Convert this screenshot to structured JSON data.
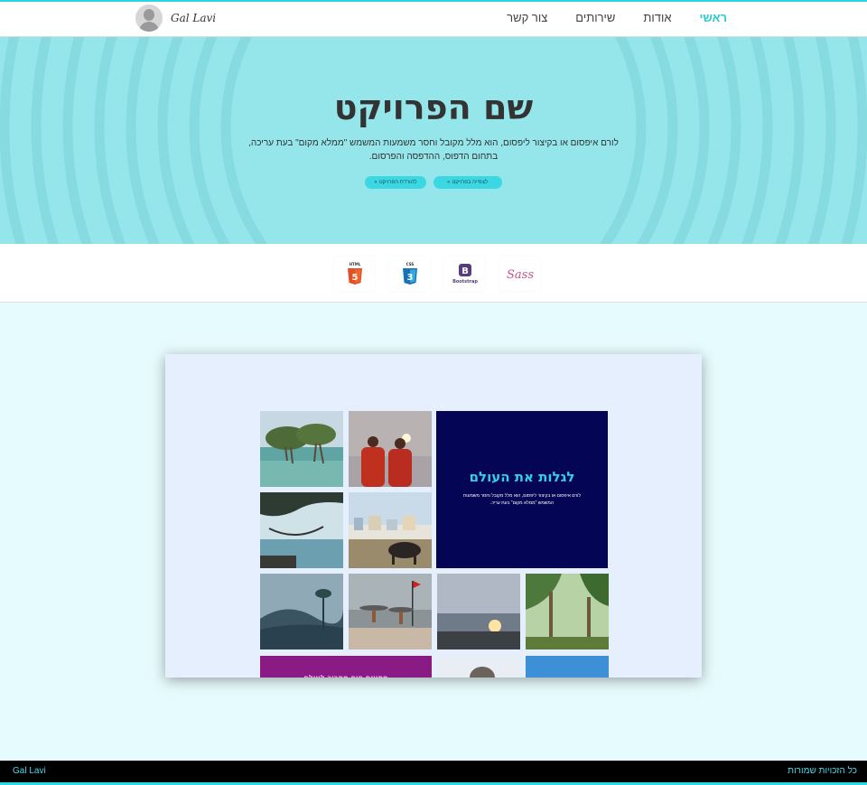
{
  "header": {
    "logo_text": "Gal Lavi",
    "nav": [
      {
        "label": "ראשי",
        "active": true
      },
      {
        "label": "אודות",
        "active": false
      },
      {
        "label": "שירותים",
        "active": false
      },
      {
        "label": "צור קשר",
        "active": false
      }
    ]
  },
  "hero": {
    "title": "שם הפרויקט",
    "description_line1": "לורם איפסום או בקיצור ליפסום, הוא מלל מקובל וחסר משמעות המשמש \"ממלא מקום\" בעת עריכה,",
    "description_line2": "בתחום הדפוס, ההדפסה והפרסום.",
    "buttons": [
      {
        "label": "לצפייה בפרויקט",
        "icon": "double-chevron-left"
      },
      {
        "label": "להורדת הפרויקט",
        "icon": "double-chevron-left"
      }
    ]
  },
  "technologies": [
    {
      "name": "Sass",
      "color": "#c6538c"
    },
    {
      "name": "Bootstrap",
      "color": "#563d7c"
    },
    {
      "name": "CSS",
      "color": "#1572b6"
    },
    {
      "name": "HTML",
      "color": "#e34f26"
    }
  ],
  "preview": {
    "feature_title": "לגלות את העולם",
    "feature_text": "לורם איפסום או בקיצור ליפסום, הוא מלל מקובל וחסר משמעות המשמש \"ממלא מקום\" בעת עריכ.",
    "promo_text": "מסעות חוף מסביב לעולם"
  },
  "footer": {
    "brand": "Gal Lavi",
    "copyright": "כל הזכויות שמורות"
  },
  "colors": {
    "accent": "#2ed6dd",
    "hero_bg": "#95e6eb",
    "feature_bg": "#050556",
    "promo_bg": "#8a1b84"
  }
}
